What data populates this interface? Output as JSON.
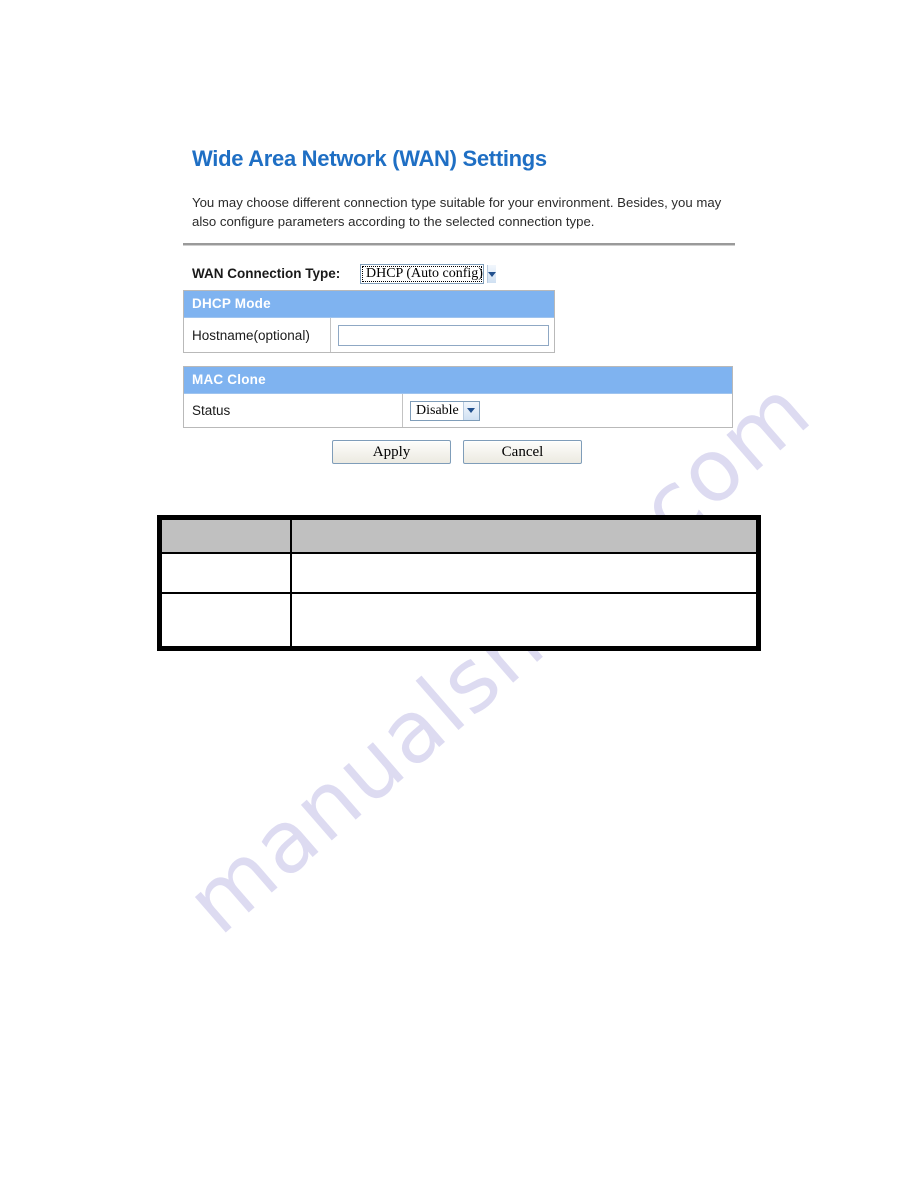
{
  "page": {
    "title": "Wide Area Network (WAN) Settings",
    "description": "You may choose different connection type suitable for your environment. Besides, you may also configure parameters according to the selected connection type.",
    "watermark": "manualshive.com",
    "title_color": "#1f6fc4",
    "section_header_color": "#7fb3f0",
    "legend_header_color": "#c0c0c0"
  },
  "wan_connection": {
    "label": "WAN Connection Type:",
    "selected": "DHCP (Auto config)",
    "dropdown_icon": "chevron-down-icon"
  },
  "dhcp_mode": {
    "header": "DHCP Mode",
    "rows": [
      {
        "label": "Hostname(optional)",
        "value": "",
        "placeholder": ""
      }
    ]
  },
  "mac_clone": {
    "header": "MAC Clone",
    "rows": [
      {
        "label": "Status",
        "selected": "Disable",
        "dropdown_icon": "chevron-down-icon"
      }
    ]
  },
  "actions": {
    "apply_label": "Apply",
    "cancel_label": "Cancel"
  },
  "legend_table": {
    "headers": [
      "",
      ""
    ],
    "rows": [
      [
        "",
        ""
      ],
      [
        "",
        ""
      ]
    ]
  }
}
